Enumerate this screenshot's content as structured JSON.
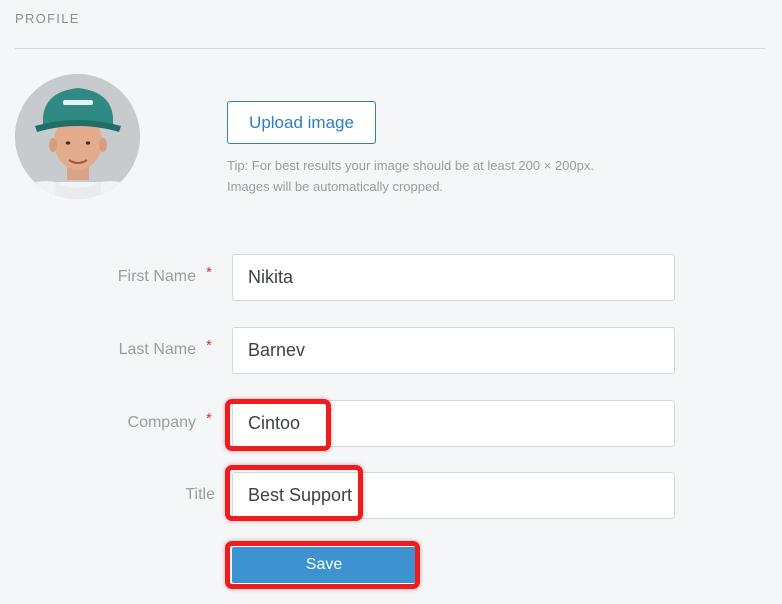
{
  "profile": {
    "section_title": "PROFILE",
    "avatar_icon": "user-avatar-photo",
    "upload_label": "Upload image",
    "tip_line1": "Tip: For best results your image should be at least 200 × 200px.",
    "tip_line2": "Images will be automatically cropped."
  },
  "form": {
    "first_name": {
      "label": "First Name",
      "value": "Nikita",
      "required": "*"
    },
    "last_name": {
      "label": "Last Name",
      "value": "Barnev",
      "required": "*"
    },
    "company": {
      "label": "Company",
      "value": "Cintoo",
      "required": "*"
    },
    "title": {
      "label": "Title",
      "value": "Best Support"
    },
    "save_label": "Save"
  },
  "colors": {
    "accent": "#2b7fc4",
    "save_button": "#3d93cf",
    "highlight": "#ee1c1c",
    "required": "#d9302c"
  }
}
